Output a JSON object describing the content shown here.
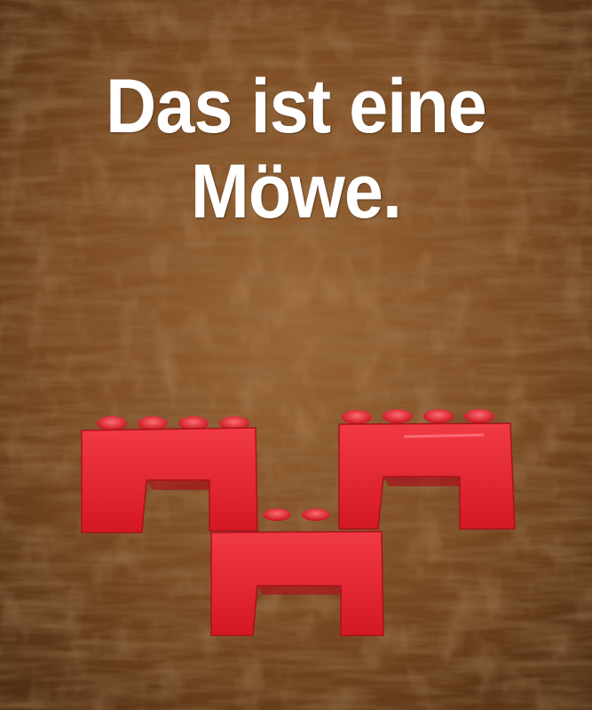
{
  "caption": {
    "line1": "Das ist eine",
    "line2": "Möwe."
  },
  "colors": {
    "wood_dark": "#4a2a12",
    "wood_mid": "#7a4a22",
    "wood_light": "#b07a44",
    "brick_red": "#e01f2b",
    "brick_shadow": "#a8121c",
    "text": "#ffffff"
  }
}
